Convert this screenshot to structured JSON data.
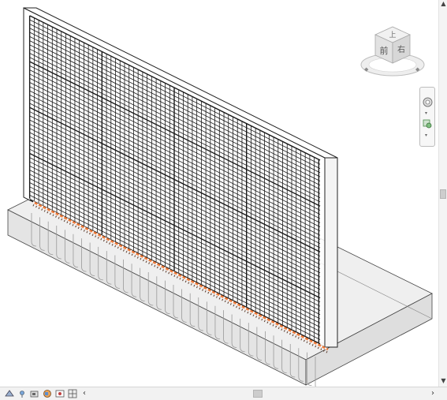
{
  "viewcube": {
    "top_face": "上",
    "front_face": "前",
    "right_face": "右"
  },
  "icons": {
    "nav_wheel": "steering-wheel-icon",
    "zoom": "zoom-region-icon",
    "view_controls": [
      "visual-style-icon",
      "sun-path-icon",
      "shadows-icon",
      "render-icon",
      "crop-region-icon",
      "temporary-hide-icon"
    ]
  },
  "colors": {
    "rebar": "#1a1a1a",
    "highlight_bar": "#f07b3a",
    "concrete_fill": "#e9e9e9",
    "outline": "#3a3a3a"
  }
}
